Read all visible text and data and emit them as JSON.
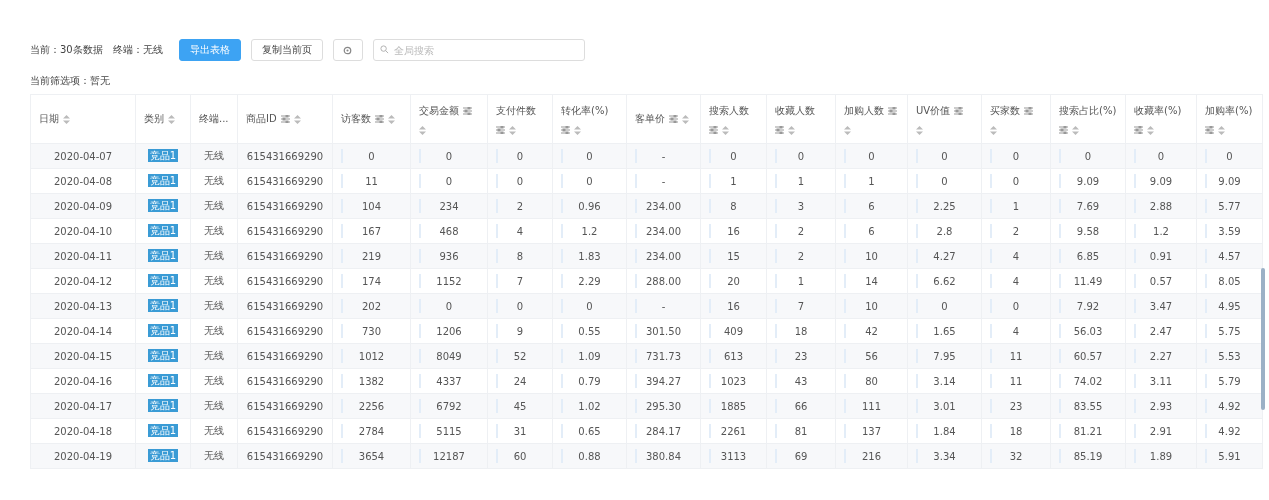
{
  "summary": {
    "count_text": "当前：30条数据",
    "terminal_text": "终端：无线"
  },
  "toolbar": {
    "export_button": "导出表格",
    "copy_button": "复制当前页",
    "search": {
      "placeholder": "全局搜索"
    }
  },
  "filter_text": "当前筛选项：暂无",
  "table": {
    "columns": [
      {
        "label": "日期",
        "filterable": false,
        "sortable": true
      },
      {
        "label": "类别",
        "filterable": false,
        "sortable": true
      },
      {
        "label": "终端...",
        "filterable": false,
        "sortable": false
      },
      {
        "label": "商品ID",
        "filterable": true,
        "sortable": true
      },
      {
        "label": "访客数",
        "filterable": true,
        "sortable": true
      },
      {
        "label": "交易金额",
        "filterable": true,
        "sortable": true
      },
      {
        "label": "支付件数",
        "filterable": true,
        "sortable": true
      },
      {
        "label": "转化率(%)",
        "filterable": true,
        "sortable": true
      },
      {
        "label": "客单价",
        "filterable": true,
        "sortable": true
      },
      {
        "label": "搜索人数",
        "filterable": true,
        "sortable": true
      },
      {
        "label": "收藏人数",
        "filterable": true,
        "sortable": true
      },
      {
        "label": "加购人数",
        "filterable": true,
        "sortable": true
      },
      {
        "label": "UV价值",
        "filterable": true,
        "sortable": true
      },
      {
        "label": "买家数",
        "filterable": true,
        "sortable": true
      },
      {
        "label": "搜索占比(%)",
        "filterable": true,
        "sortable": true
      },
      {
        "label": "收藏率(%)",
        "filterable": true,
        "sortable": true
      },
      {
        "label": "加购率(%)",
        "filterable": true,
        "sortable": true
      }
    ],
    "rows": [
      [
        "2020-04-07",
        "竞品1",
        "无线",
        "615431669290",
        "0",
        "0",
        "0",
        "0",
        "-",
        "0",
        "0",
        "0",
        "0",
        "0",
        "0",
        "0",
        "0"
      ],
      [
        "2020-04-08",
        "竞品1",
        "无线",
        "615431669290",
        "11",
        "0",
        "0",
        "0",
        "-",
        "1",
        "1",
        "1",
        "0",
        "0",
        "9.09",
        "9.09",
        "9.09"
      ],
      [
        "2020-04-09",
        "竞品1",
        "无线",
        "615431669290",
        "104",
        "234",
        "2",
        "0.96",
        "234.00",
        "8",
        "3",
        "6",
        "2.25",
        "1",
        "7.69",
        "2.88",
        "5.77"
      ],
      [
        "2020-04-10",
        "竞品1",
        "无线",
        "615431669290",
        "167",
        "468",
        "4",
        "1.2",
        "234.00",
        "16",
        "2",
        "6",
        "2.8",
        "2",
        "9.58",
        "1.2",
        "3.59"
      ],
      [
        "2020-04-11",
        "竞品1",
        "无线",
        "615431669290",
        "219",
        "936",
        "8",
        "1.83",
        "234.00",
        "15",
        "2",
        "10",
        "4.27",
        "4",
        "6.85",
        "0.91",
        "4.57"
      ],
      [
        "2020-04-12",
        "竞品1",
        "无线",
        "615431669290",
        "174",
        "1152",
        "7",
        "2.29",
        "288.00",
        "20",
        "1",
        "14",
        "6.62",
        "4",
        "11.49",
        "0.57",
        "8.05"
      ],
      [
        "2020-04-13",
        "竞品1",
        "无线",
        "615431669290",
        "202",
        "0",
        "0",
        "0",
        "-",
        "16",
        "7",
        "10",
        "0",
        "0",
        "7.92",
        "3.47",
        "4.95"
      ],
      [
        "2020-04-14",
        "竞品1",
        "无线",
        "615431669290",
        "730",
        "1206",
        "9",
        "0.55",
        "301.50",
        "409",
        "18",
        "42",
        "1.65",
        "4",
        "56.03",
        "2.47",
        "5.75"
      ],
      [
        "2020-04-15",
        "竞品1",
        "无线",
        "615431669290",
        "1012",
        "8049",
        "52",
        "1.09",
        "731.73",
        "613",
        "23",
        "56",
        "7.95",
        "11",
        "60.57",
        "2.27",
        "5.53"
      ],
      [
        "2020-04-16",
        "竞品1",
        "无线",
        "615431669290",
        "1382",
        "4337",
        "24",
        "0.79",
        "394.27",
        "1023",
        "43",
        "80",
        "3.14",
        "11",
        "74.02",
        "3.11",
        "5.79"
      ],
      [
        "2020-04-17",
        "竞品1",
        "无线",
        "615431669290",
        "2256",
        "6792",
        "45",
        "1.02",
        "295.30",
        "1885",
        "66",
        "111",
        "3.01",
        "23",
        "83.55",
        "2.93",
        "4.92"
      ],
      [
        "2020-04-18",
        "竞品1",
        "无线",
        "615431669290",
        "2784",
        "5115",
        "31",
        "0.65",
        "284.17",
        "2261",
        "81",
        "137",
        "1.84",
        "18",
        "81.21",
        "2.91",
        "4.92"
      ],
      [
        "2020-04-19",
        "竞品1",
        "无线",
        "615431669290",
        "3654",
        "12187",
        "60",
        "0.88",
        "380.84",
        "3113",
        "69",
        "216",
        "3.34",
        "32",
        "85.19",
        "1.89",
        "5.91"
      ]
    ]
  }
}
